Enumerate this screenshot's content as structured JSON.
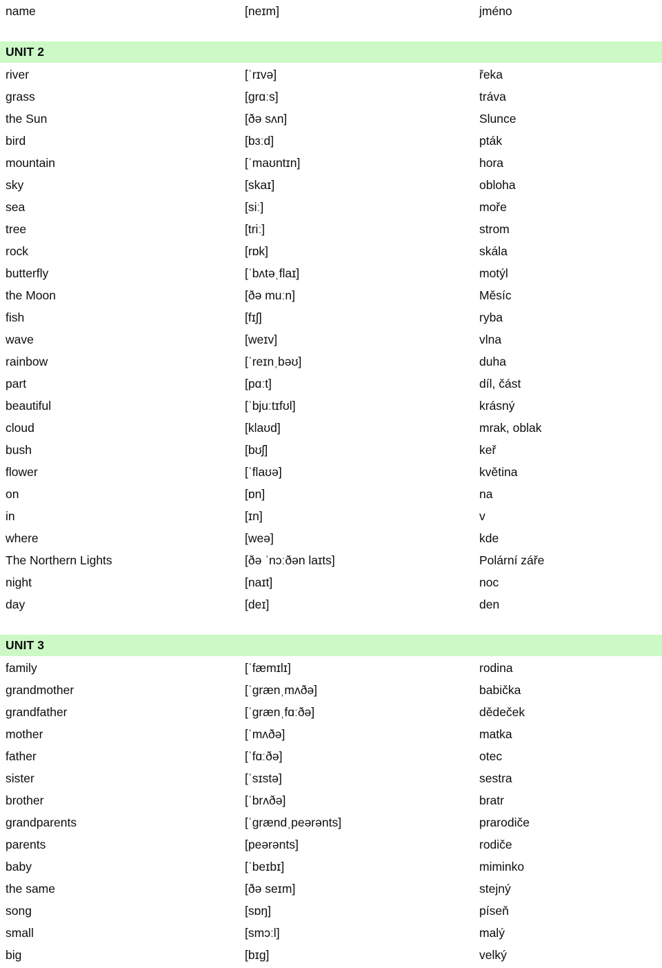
{
  "document": {
    "type": "vocabulary-glossary",
    "columns": [
      "english",
      "ipa",
      "czech"
    ],
    "accent_color": "#ccf9c6",
    "text_color": "#0d0d0d"
  },
  "leading_rows": [
    {
      "english": "name",
      "ipa": "[neɪm]",
      "czech": "jméno"
    }
  ],
  "units": [
    {
      "heading": "UNIT 2",
      "rows": [
        {
          "english": "river",
          "ipa": "[ˈrɪvə]",
          "czech": "řeka"
        },
        {
          "english": "grass",
          "ipa": "[grɑːs]",
          "czech": "tráva"
        },
        {
          "english": "the Sun",
          "ipa": "[ðə sʌn]",
          "czech": "Slunce"
        },
        {
          "english": "bird",
          "ipa": "[bɜːd]",
          "czech": "pták"
        },
        {
          "english": "mountain",
          "ipa": "[ˈmaʊntɪn]",
          "czech": "hora"
        },
        {
          "english": "sky",
          "ipa": "[skaɪ]",
          "czech": "obloha"
        },
        {
          "english": "sea",
          "ipa": "[siː]",
          "czech": "moře"
        },
        {
          "english": "tree",
          "ipa": "[triː]",
          "czech": "strom"
        },
        {
          "english": "rock",
          "ipa": "[rɒk]",
          "czech": "skála"
        },
        {
          "english": "butterfly",
          "ipa": "[ˈbʌtəˌflaɪ]",
          "czech": "motýl"
        },
        {
          "english": "the Moon",
          "ipa": "[ðə muːn]",
          "czech": "Měsíc"
        },
        {
          "english": "fish",
          "ipa": "[fɪʃ]",
          "czech": "ryba"
        },
        {
          "english": "wave",
          "ipa": "[weɪv]",
          "czech": "vlna"
        },
        {
          "english": "rainbow",
          "ipa": "[ˈreɪnˌbəʊ]",
          "czech": "duha"
        },
        {
          "english": "part",
          "ipa": "[pɑːt]",
          "czech": "díl, část"
        },
        {
          "english": "beautiful",
          "ipa": "[ˈbjuːtɪfʊl]",
          "czech": "krásný"
        },
        {
          "english": "cloud",
          "ipa": "[klaʊd]",
          "czech": "mrak, oblak"
        },
        {
          "english": "bush",
          "ipa": "[bʊʃ]",
          "czech": "keř"
        },
        {
          "english": "flower",
          "ipa": "[ˈflaʊə]",
          "czech": "květina"
        },
        {
          "english": "on",
          "ipa": "[ɒn]",
          "czech": "na"
        },
        {
          "english": "in",
          "ipa": "[ɪn]",
          "czech": "v"
        },
        {
          "english": "where",
          "ipa": "[weə]",
          "czech": "kde"
        },
        {
          "english": "The Northern Lights",
          "ipa": "[ðə ˈnɔːðən laɪts]",
          "czech": "Polární záře"
        },
        {
          "english": "night",
          "ipa": "[naɪt]",
          "czech": "noc"
        },
        {
          "english": "day",
          "ipa": "[deɪ]",
          "czech": "den"
        }
      ]
    },
    {
      "heading": "UNIT 3",
      "rows": [
        {
          "english": "family",
          "ipa": "[ˈfæmɪlɪ]",
          "czech": "rodina"
        },
        {
          "english": "grandmother",
          "ipa": "[ˈgrænˌmʌðə]",
          "czech": "babička"
        },
        {
          "english": "grandfather",
          "ipa": "[ˈgrænˌfɑːðə]",
          "czech": "dědeček"
        },
        {
          "english": "mother",
          "ipa": "[ˈmʌðə]",
          "czech": "matka"
        },
        {
          "english": "father",
          "ipa": "[ˈfɑːðə]",
          "czech": "otec"
        },
        {
          "english": "sister",
          "ipa": "[ˈsɪstə]",
          "czech": "sestra"
        },
        {
          "english": "brother",
          "ipa": "[ˈbrʌðə]",
          "czech": "bratr"
        },
        {
          "english": "grandparents",
          "ipa": "[ˈgrændˌpeərənts]",
          "czech": "prarodiče"
        },
        {
          "english": "parents",
          "ipa": "[peərənts]",
          "czech": "rodiče"
        },
        {
          "english": "baby",
          "ipa": "[ˈbeɪbɪ]",
          "czech": "miminko"
        },
        {
          "english": "the same",
          "ipa": "[ðə seɪm]",
          "czech": "stejný"
        },
        {
          "english": "song",
          "ipa": "[sɒŋ]",
          "czech": "píseň"
        },
        {
          "english": "small",
          "ipa": "[smɔːl]",
          "czech": "malý"
        },
        {
          "english": "big",
          "ipa": "[bɪg]",
          "czech": "velký"
        }
      ]
    }
  ]
}
